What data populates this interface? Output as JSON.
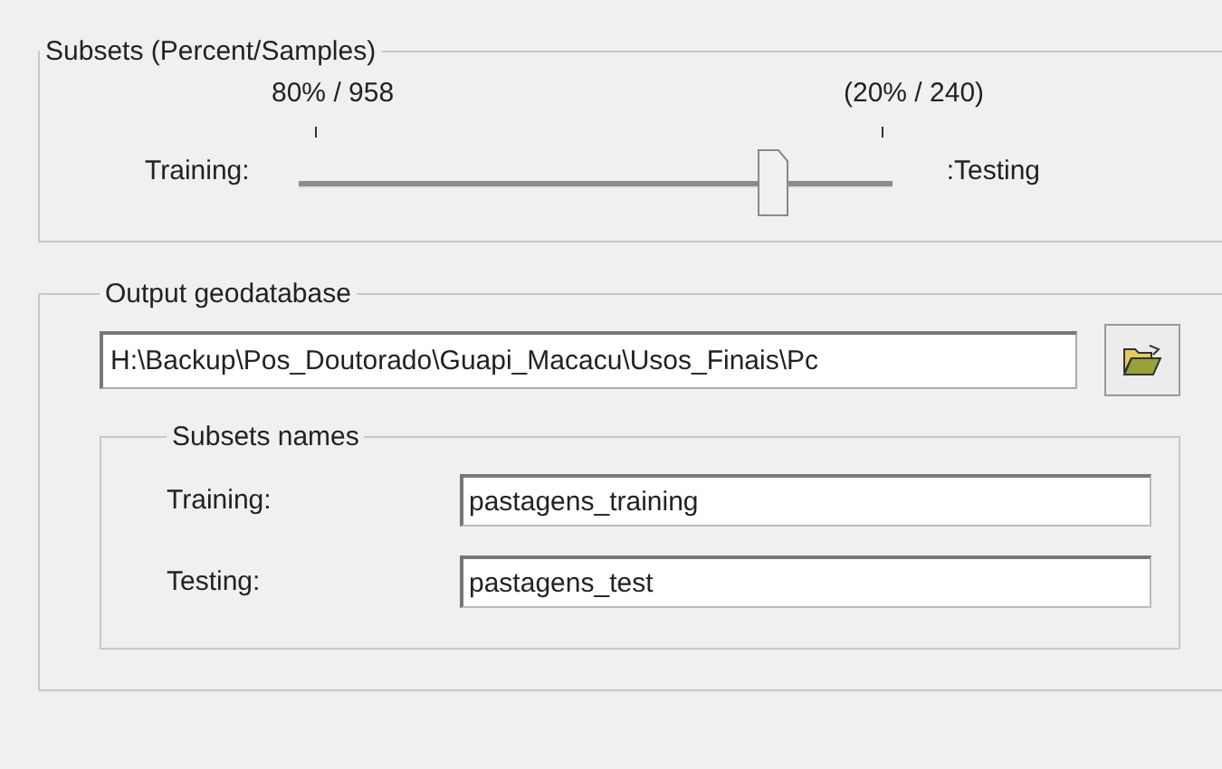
{
  "subsets": {
    "title": "Subsets (Percent/Samples)",
    "training_share": "80% / 958",
    "testing_share": "(20% / 240)",
    "left_label": "Training:",
    "right_label": ":Testing",
    "slider": {
      "level": 0.8
    }
  },
  "output": {
    "title": "Output geodatabase",
    "path": "H:\\Backup\\Pos_Doutorado\\Guapi_Macacu\\Usos_Finais\\Pc",
    "names": {
      "title": "Subsets names",
      "rows": [
        {
          "label": "Training:",
          "value": "pastagens_training"
        },
        {
          "label": "Testing:",
          "value": "pastagens_test"
        }
      ]
    }
  }
}
